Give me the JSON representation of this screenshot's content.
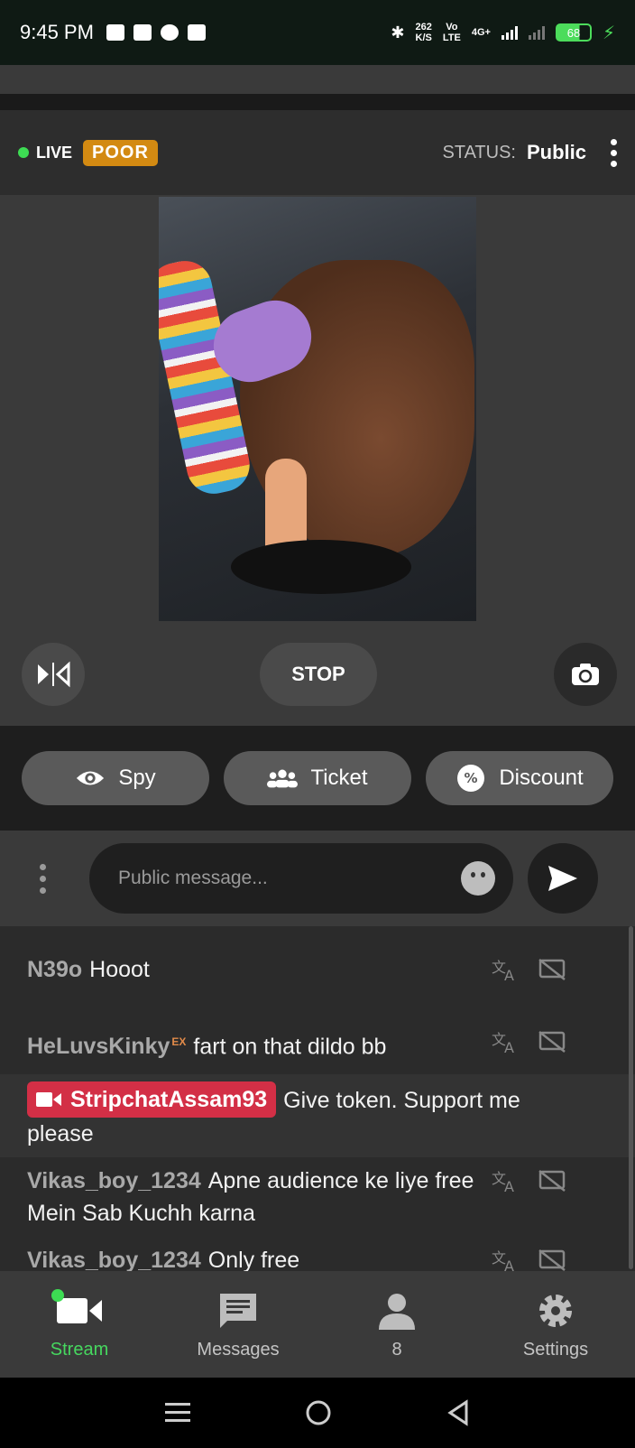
{
  "status_bar": {
    "time": "9:45 PM",
    "speed_value": "262",
    "speed_unit": "K/S",
    "net_label_1": "Vo",
    "net_label_2": "LTE",
    "net_label_3": "4G+",
    "battery": "68"
  },
  "stream": {
    "live_label": "LIVE",
    "quality_badge": "POOR",
    "status_label": "STATUS:",
    "status_value": "Public",
    "stop_label": "STOP"
  },
  "actions": {
    "spy_label": "Spy",
    "ticket_label": "Ticket",
    "discount_label": "Discount"
  },
  "composer": {
    "placeholder": "Public message..."
  },
  "chat": {
    "messages": [
      {
        "user": "N39o",
        "text": "Hooot"
      },
      {
        "user": "HeLuvsKinky",
        "badge": "EX",
        "text": "fart on that dildo bb"
      },
      {
        "user": "StripchatAssam93",
        "text": "Give token. Support me please"
      },
      {
        "user": "Vikas_boy_1234",
        "text": "Apne audience ke liye free Mein Sab Kuchh karna"
      },
      {
        "user": "Vikas_boy_1234",
        "text": "Only free"
      }
    ]
  },
  "bottom_nav": {
    "stream": "Stream",
    "messages": "Messages",
    "viewers": "8",
    "settings": "Settings"
  },
  "colors": {
    "accent_green": "#46d75f",
    "poor_badge": "#d38a12",
    "broadcaster_tag": "#d32f46"
  }
}
